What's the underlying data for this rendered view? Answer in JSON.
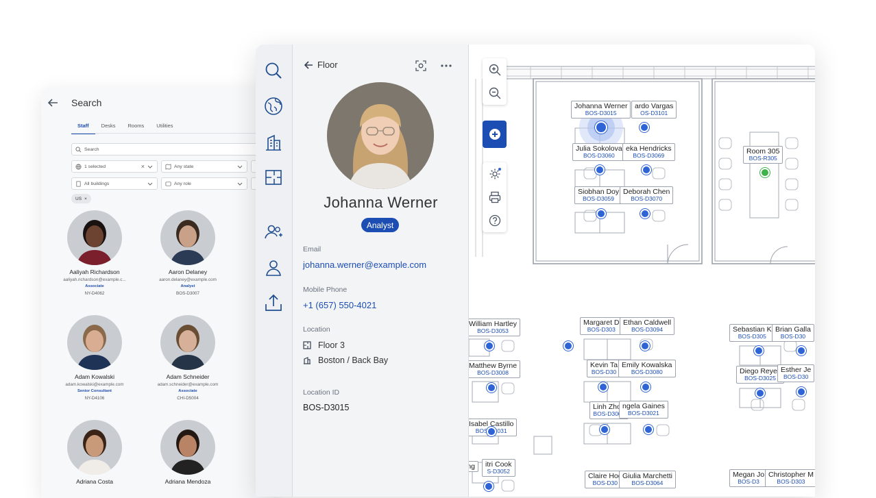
{
  "search_panel": {
    "title": "Search",
    "tabs": [
      "Staff",
      "Desks",
      "Rooms",
      "Utilities"
    ],
    "active_tab": "Staff",
    "search_placeholder": "Search",
    "filters": {
      "country": "1 selected",
      "state": "Any state",
      "buildings": "All buildings",
      "role": "Any role"
    },
    "chip": "US",
    "people": [
      {
        "name": "Aaliyah Richardson",
        "email": "aaliyah.richardson@example.c...",
        "role": "Associate",
        "location": "NY-D4062",
        "skin": "#6b4330",
        "hair": "#1a1210",
        "shirt": "#7a1f2b"
      },
      {
        "name": "Aaron Delaney",
        "email": "aaron.delaney@example.com",
        "role": "Analyst",
        "location": "BOS-D3007",
        "skin": "#c9a188",
        "hair": "#3a2a20",
        "shirt": "#2b3b55"
      },
      {
        "name": "Adam Kowalski",
        "email": "adam.kowalski@example.com",
        "role": "Senior Consultant",
        "location": "NY-D4106",
        "skin": "#d8ad92",
        "hair": "#8a6a4a",
        "shirt": "#1f3357"
      },
      {
        "name": "Adam Schneider",
        "email": "adam.schneider@example.com",
        "role": "Associate",
        "location": "CHI-D5004",
        "skin": "#d6b098",
        "hair": "#6a4e34",
        "shirt": "#263447"
      },
      {
        "name": "Adriana Costa",
        "email": "",
        "role": "",
        "location": "",
        "skin": "#c99a7a",
        "hair": "#3a2418",
        "shirt": "#f0ede8"
      },
      {
        "name": "Adriana Mendoza",
        "email": "",
        "role": "",
        "location": "",
        "skin": "#b98466",
        "hair": "#241812",
        "shirt": "#222222"
      }
    ]
  },
  "detail": {
    "back_label": "Floor",
    "name": "Johanna Werner",
    "role_badge": "Analyst",
    "email_label": "Email",
    "email": "johanna.werner@example.com",
    "phone_label": "Mobile Phone",
    "phone": "+1 (657) 550-4021",
    "location_label": "Location",
    "floor": "Floor 3",
    "building": "Boston / Back Bay",
    "location_id_label": "Location ID",
    "location_id": "BOS-D3015"
  },
  "floor_map": {
    "desks": [
      {
        "name": "Johanna Werner",
        "code": "BOS-D3015"
      },
      {
        "name": "ardo Vargas",
        "code": "OS-D3101"
      },
      {
        "name": "Julia Sokolova",
        "code": "BOS-D3060"
      },
      {
        "name": "eka Hendricks",
        "code": "BOS-D3069"
      },
      {
        "name": "Siobhan Doy",
        "code": "BOS-D3059"
      },
      {
        "name": "Deborah Chen",
        "code": "BOS-D3070"
      },
      {
        "name": "Room 305",
        "code": "BOS-R305"
      },
      {
        "name": "William Hartley",
        "code": "BOS-D3053"
      },
      {
        "name": "Matthew Byrne",
        "code": "BOS-D3008"
      },
      {
        "name": "Isabel Castillo",
        "code": "BOS-D3031"
      },
      {
        "name": "itri Cook",
        "code": "S-D3052"
      },
      {
        "name": "ing",
        "code": ""
      },
      {
        "name": "Margaret D",
        "code": "BOS-D303"
      },
      {
        "name": "Ethan Caldwell",
        "code": "BOS-D3094"
      },
      {
        "name": "Kevin Ta",
        "code": "BOS-D30"
      },
      {
        "name": "Emily Kowalska",
        "code": "BOS-D3080"
      },
      {
        "name": "Linh Zhou",
        "code": "BOS-D3006"
      },
      {
        "name": "ngela Gaines",
        "code": "BOS-D3021"
      },
      {
        "name": "Claire Hog",
        "code": "BOS-D30"
      },
      {
        "name": "Giulia Marchetti",
        "code": "BOS-D3064"
      },
      {
        "name": "Sebastian K",
        "code": "BOS-D305"
      },
      {
        "name": "Brian Galla",
        "code": "BOS-D30"
      },
      {
        "name": "Diego Reyes",
        "code": "BOS-D3025"
      },
      {
        "name": "Esther Je",
        "code": "BOS-D30"
      },
      {
        "name": "Megan Jo",
        "code": "BOS-D3"
      },
      {
        "name": "Christopher M",
        "code": "BOS-D303"
      }
    ]
  },
  "colors": {
    "accent": "#1b4db3",
    "pin": "#2f64d6",
    "room_pin": "#3fb24a"
  }
}
